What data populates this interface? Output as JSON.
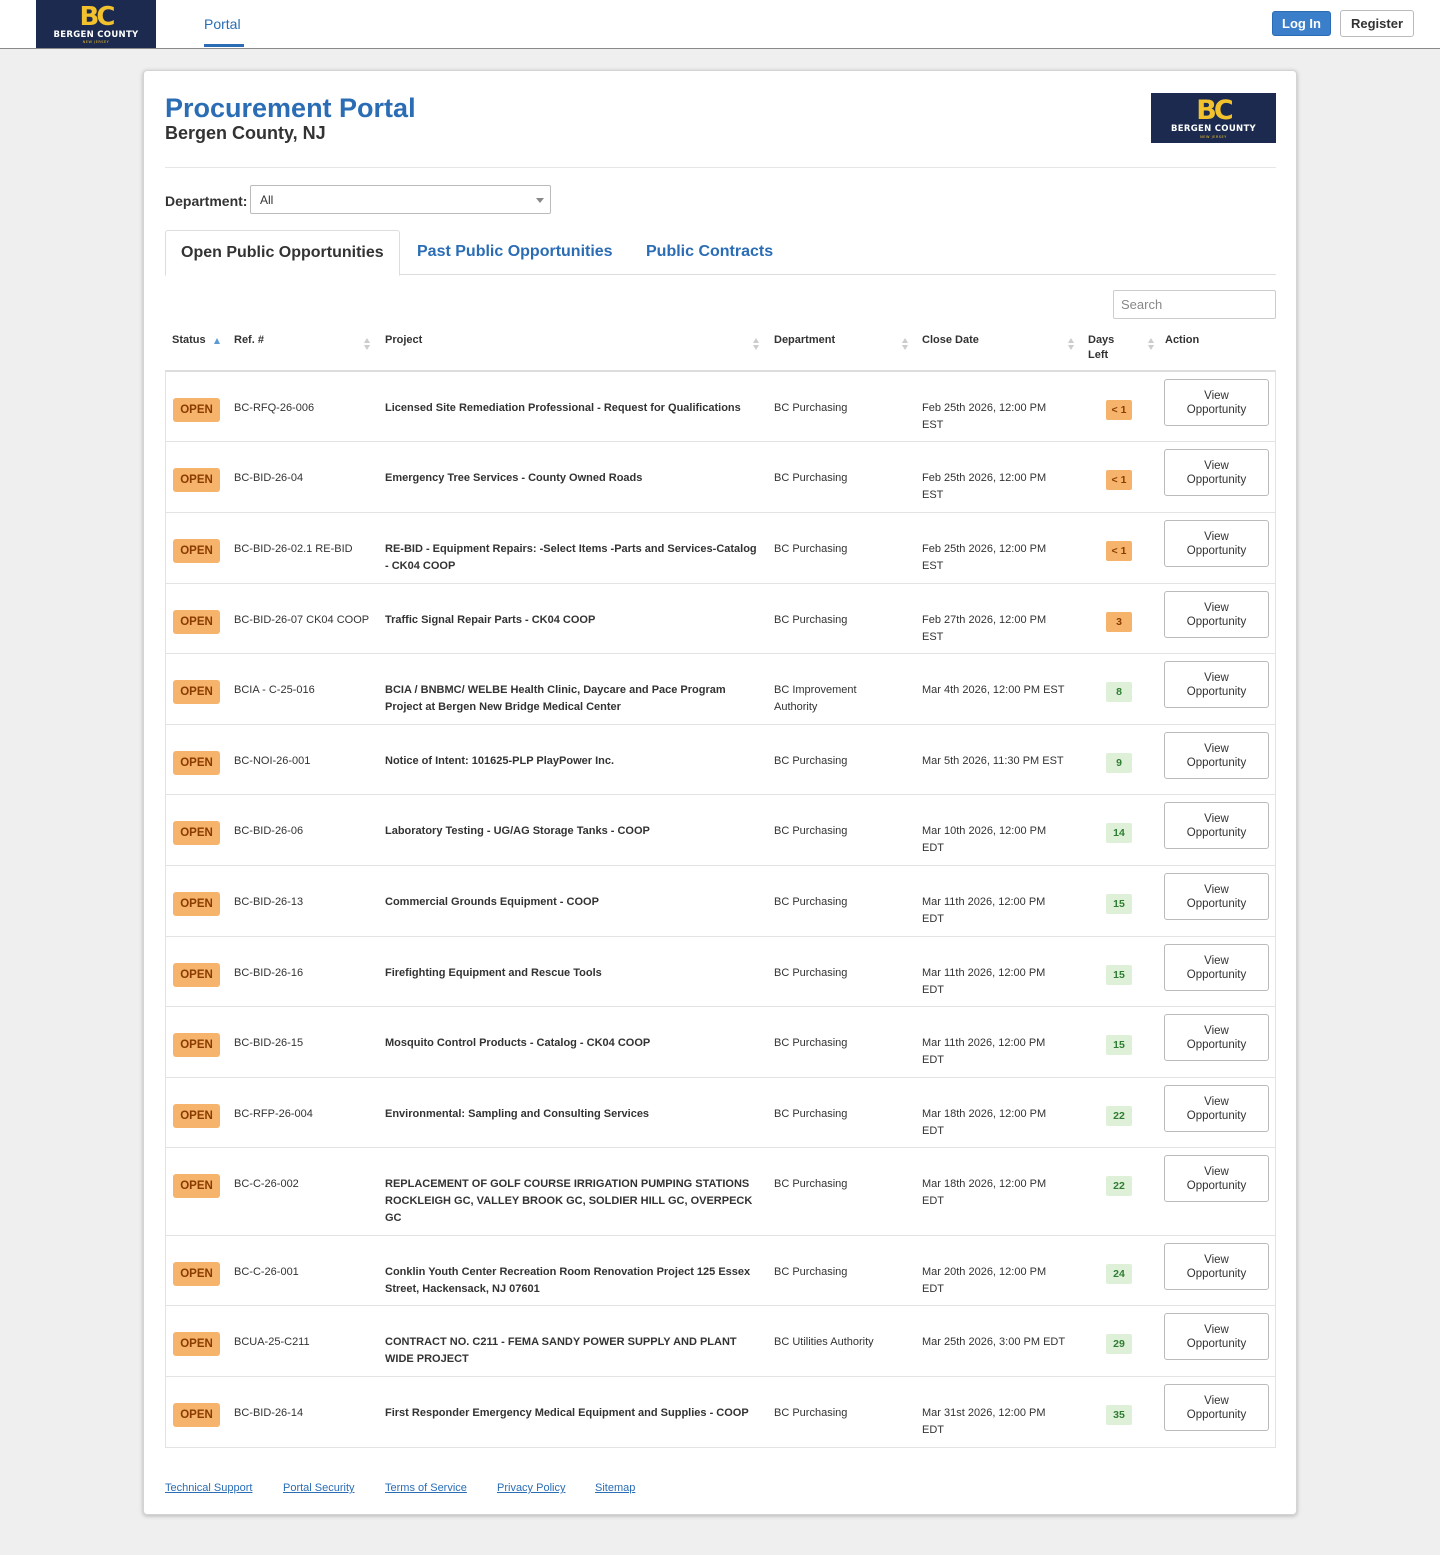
{
  "nav": {
    "logo_mark": "BC",
    "logo_text": "BERGEN COUNTY",
    "logo_sub": "NEW JERSEY",
    "portal": "Portal",
    "login": "Log In",
    "register": "Register"
  },
  "header": {
    "title": "Procurement Portal",
    "subtitle": "Bergen County, NJ"
  },
  "department": {
    "label": "Department:",
    "selected": "All"
  },
  "tabs": [
    "Open Public Opportunities",
    "Past Public Opportunities",
    "Public Contracts"
  ],
  "search": {
    "placeholder": "Search"
  },
  "columns": [
    "Status",
    "Ref. #",
    "Project",
    "Department",
    "Close Date",
    "Days Left",
    "Action"
  ],
  "rows": [
    {
      "status": "OPEN",
      "ref": "BC-RFQ-26-006",
      "project": "Licensed Site Remediation Professional - Request for Qualifications",
      "dept": "BC Purchasing",
      "close": "Feb 25th 2026, 12:00 PM EST",
      "days": "< 1",
      "action": "View Opportunity"
    },
    {
      "status": "OPEN",
      "ref": "BC-BID-26-04",
      "project": "Emergency Tree Services - County Owned Roads",
      "dept": "BC Purchasing",
      "close": "Feb 25th 2026, 12:00 PM EST",
      "days": "< 1",
      "action": "View Opportunity"
    },
    {
      "status": "OPEN",
      "ref": "BC-BID-26-02.1 RE-BID",
      "project": "RE-BID - Equipment Repairs: -Select Items -Parts and Services-Catalog - CK04 COOP",
      "dept": "BC Purchasing",
      "close": "Feb 25th 2026, 12:00 PM EST",
      "days": "< 1",
      "action": "View Opportunity"
    },
    {
      "status": "OPEN",
      "ref": "BC-BID-26-07 CK04 COOP",
      "project": "Traffic Signal Repair Parts - CK04 COOP",
      "dept": "BC Purchasing",
      "close": "Feb 27th 2026, 12:00 PM EST",
      "days": "3",
      "action": "View Opportunity"
    },
    {
      "status": "OPEN",
      "ref": "BCIA - C-25-016",
      "project": "BCIA / BNBMC/ WELBE Health Clinic, Daycare and Pace Program Project at Bergen New Bridge Medical Center",
      "dept": "BC Improvement Authority",
      "close": "Mar 4th 2026, 12:00 PM EST",
      "days": "8",
      "action": "View Opportunity"
    },
    {
      "status": "OPEN",
      "ref": "BC-NOI-26-001",
      "project": "Notice of Intent: 101625-PLP PlayPower Inc.",
      "dept": "BC Purchasing",
      "close": "Mar 5th 2026, 11:30 PM EST",
      "days": "9",
      "action": "View Opportunity"
    },
    {
      "status": "OPEN",
      "ref": "BC-BID-26-06",
      "project": "Laboratory Testing - UG/AG Storage Tanks - COOP",
      "dept": "BC Purchasing",
      "close": "Mar 10th 2026, 12:00 PM EDT",
      "days": "14",
      "action": "View Opportunity"
    },
    {
      "status": "OPEN",
      "ref": "BC-BID-26-13",
      "project": "Commercial Grounds Equipment - COOP",
      "dept": "BC Purchasing",
      "close": "Mar 11th 2026, 12:00 PM EDT",
      "days": "15",
      "action": "View Opportunity"
    },
    {
      "status": "OPEN",
      "ref": "BC-BID-26-16",
      "project": "Firefighting Equipment and Rescue Tools",
      "dept": "BC Purchasing",
      "close": "Mar 11th 2026, 12:00 PM EDT",
      "days": "15",
      "action": "View Opportunity"
    },
    {
      "status": "OPEN",
      "ref": "BC-BID-26-15",
      "project": "Mosquito Control Products - Catalog - CK04 COOP",
      "dept": "BC Purchasing",
      "close": "Mar 11th 2026, 12:00 PM EDT",
      "days": "15",
      "action": "View Opportunity"
    },
    {
      "status": "OPEN",
      "ref": "BC-RFP-26-004",
      "project": "Environmental: Sampling and Consulting Services",
      "dept": "BC Purchasing",
      "close": "Mar 18th 2026, 12:00 PM EDT",
      "days": "22",
      "action": "View Opportunity"
    },
    {
      "status": "OPEN",
      "ref": "BC-C-26-002",
      "project": "REPLACEMENT OF GOLF COURSE IRRIGATION PUMPING STATIONS ROCKLEIGH GC, VALLEY BROOK GC, SOLDIER HILL GC, OVERPECK GC",
      "dept": "BC Purchasing",
      "close": "Mar 18th 2026, 12:00 PM EDT",
      "days": "22",
      "action": "View Opportunity"
    },
    {
      "status": "OPEN",
      "ref": "BC-C-26-001",
      "project": "Conklin Youth Center Recreation Room Renovation Project 125 Essex Street, Hackensack, NJ 07601",
      "dept": "BC Purchasing",
      "close": "Mar 20th 2026, 12:00 PM EDT",
      "days": "24",
      "action": "View Opportunity"
    },
    {
      "status": "OPEN",
      "ref": "BCUA-25-C211",
      "project": "CONTRACT NO. C211 - FEMA SANDY POWER SUPPLY AND PLANT WIDE PROJECT",
      "dept": "BC Utilities Authority",
      "close": "Mar 25th 2026, 3:00 PM EDT",
      "days": "29",
      "action": "View Opportunity"
    },
    {
      "status": "OPEN",
      "ref": "BC-BID-26-14",
      "project": "First Responder Emergency Medical Equipment and Supplies - COOP",
      "dept": "BC Purchasing",
      "close": "Mar 31st 2026, 12:00 PM EDT",
      "days": "35",
      "action": "View Opportunity"
    }
  ],
  "footer": [
    "Technical Support",
    "Portal Security",
    "Terms of Service",
    "Privacy Policy",
    "Sitemap"
  ],
  "colors": {
    "accent": "#2a6db5",
    "open_badge": "#f6b36b",
    "days_urgent": "#f6b36b",
    "days_ok": "#dff0d8",
    "logo_bg": "#1b2a4e",
    "logo_gold": "#f2c12e"
  }
}
